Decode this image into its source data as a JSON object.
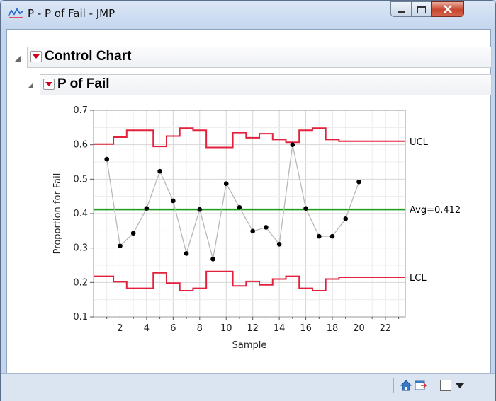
{
  "window": {
    "title": "P - P of Fail - JMP"
  },
  "report": {
    "outline_title": "Control Chart",
    "chart_title": "P of Fail"
  },
  "chart_data": {
    "type": "line",
    "xlabel": "Sample",
    "ylabel": "Proportion for Fail",
    "xlim": [
      0,
      23.5
    ],
    "ylim": [
      0.1,
      0.7
    ],
    "x_ticks": [
      2,
      4,
      6,
      8,
      10,
      12,
      14,
      16,
      18,
      20,
      22
    ],
    "y_ticks": [
      0.1,
      0.2,
      0.3,
      0.4,
      0.5,
      0.6,
      0.7
    ],
    "grid": true,
    "samples": [
      1,
      2,
      3,
      4,
      5,
      6,
      7,
      8,
      9,
      10,
      11,
      12,
      13,
      14,
      15,
      16,
      17,
      18,
      19,
      20
    ],
    "proportions": [
      0.558,
      0.306,
      0.343,
      0.415,
      0.523,
      0.437,
      0.284,
      0.412,
      0.268,
      0.487,
      0.418,
      0.349,
      0.36,
      0.311,
      0.6,
      0.415,
      0.334,
      0.334,
      0.385,
      0.492
    ],
    "center_line": {
      "label": "Avg=0.412",
      "value": 0.412,
      "color": "#1a9e1a"
    },
    "ucl": {
      "label": "UCL",
      "color": "#e3213c",
      "steps": [
        0.602,
        0.622,
        0.642,
        0.642,
        0.595,
        0.625,
        0.648,
        0.642,
        0.592,
        0.592,
        0.635,
        0.62,
        0.632,
        0.615,
        0.607,
        0.642,
        0.648,
        0.615,
        0.61,
        0.61
      ],
      "extend_value": 0.61
    },
    "lcl": {
      "label": "LCL",
      "color": "#e3213c",
      "steps": [
        0.218,
        0.202,
        0.183,
        0.183,
        0.228,
        0.198,
        0.176,
        0.183,
        0.232,
        0.232,
        0.19,
        0.203,
        0.193,
        0.21,
        0.218,
        0.183,
        0.176,
        0.21,
        0.215,
        0.215
      ],
      "extend_value": 0.215
    },
    "series_color": "#b8b8b8",
    "point_color": "#000000"
  }
}
